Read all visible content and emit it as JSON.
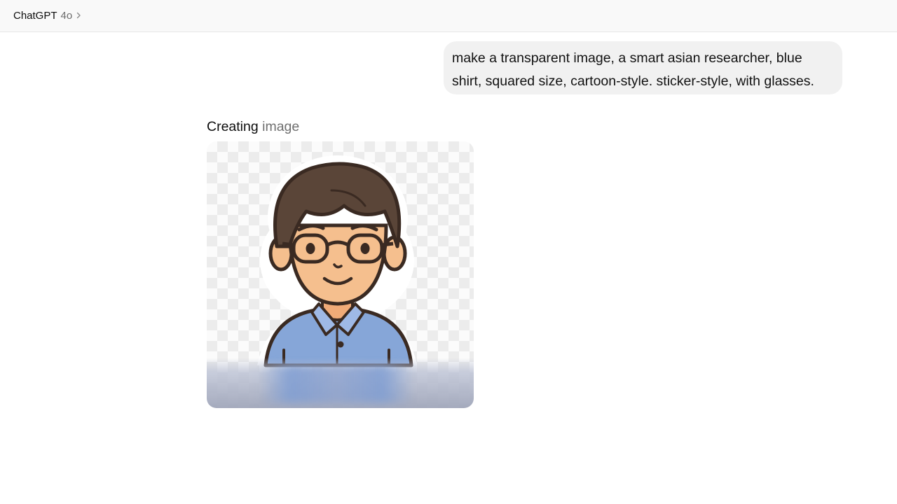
{
  "header": {
    "model_name": "ChatGPT",
    "model_version": "4o",
    "chevron_icon": "chevron-right-icon"
  },
  "conversation": {
    "user_message": "make a transparent image, a smart asian researcher, blue shirt, squared size, cartoon-style. sticker-style, with glasses.",
    "assistant_status": {
      "verb": "Creating",
      "noun": "image"
    }
  },
  "generated_image": {
    "kind": "cartoon-sticker-illustration",
    "state": "in-progress",
    "colors": {
      "checker_light": "#fbfbfb",
      "checker_dark": "#ececec",
      "hair": "#5a4538",
      "skin": "#f5bf8e",
      "outline": "#3a2a22",
      "shirt": "#86a6d8",
      "sticker_border": "#ffffff"
    }
  }
}
